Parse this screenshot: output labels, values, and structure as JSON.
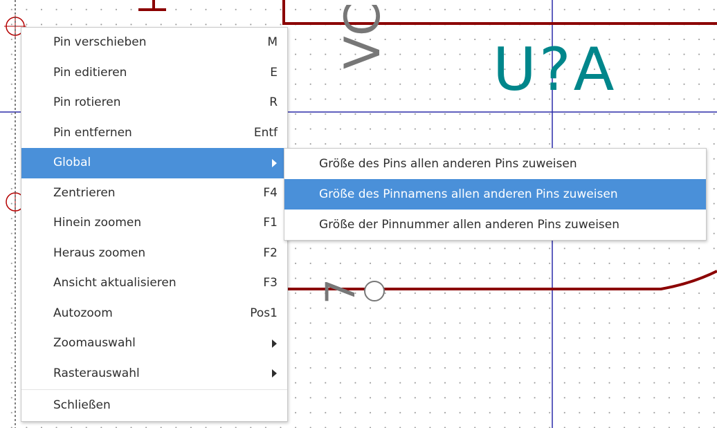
{
  "schematic": {
    "reference": "U?A",
    "pin_name": "VCC",
    "pin_number": "7",
    "colors": {
      "body": "#8b0000",
      "reference": "#00868b",
      "pin_text": "#777777",
      "axis": "#2a2aa8",
      "grid": "#9a9a9a"
    }
  },
  "context_menu": {
    "items": [
      {
        "label": "Pin verschieben",
        "shortcut": "M"
      },
      {
        "label": "Pin editieren",
        "shortcut": "E"
      },
      {
        "label": "Pin rotieren",
        "shortcut": "R"
      },
      {
        "label": "Pin entfernen",
        "shortcut": "Entf"
      },
      {
        "label": "Global",
        "shortcut": "",
        "submenu": true,
        "highlighted": true
      },
      {
        "label": "Zentrieren",
        "shortcut": "F4"
      },
      {
        "label": "Hinein zoomen",
        "shortcut": "F1"
      },
      {
        "label": "Heraus zoomen",
        "shortcut": "F2"
      },
      {
        "label": "Ansicht aktualisieren",
        "shortcut": "F3"
      },
      {
        "label": "Autozoom",
        "shortcut": "Pos1"
      },
      {
        "label": "Zoomauswahl",
        "shortcut": "",
        "submenu": true
      },
      {
        "label": "Rasterauswahl",
        "shortcut": "",
        "submenu": true
      },
      {
        "label": "Schließen",
        "shortcut": ""
      }
    ],
    "highlight_color": "#4a90d9"
  },
  "global_submenu": {
    "items": [
      {
        "label": "Größe des Pins allen anderen Pins zuweisen"
      },
      {
        "label": "Größe des Pinnamens allen anderen Pins zuweisen",
        "highlighted": true
      },
      {
        "label": "Größe der Pinnummer allen anderen Pins zuweisen"
      }
    ]
  }
}
